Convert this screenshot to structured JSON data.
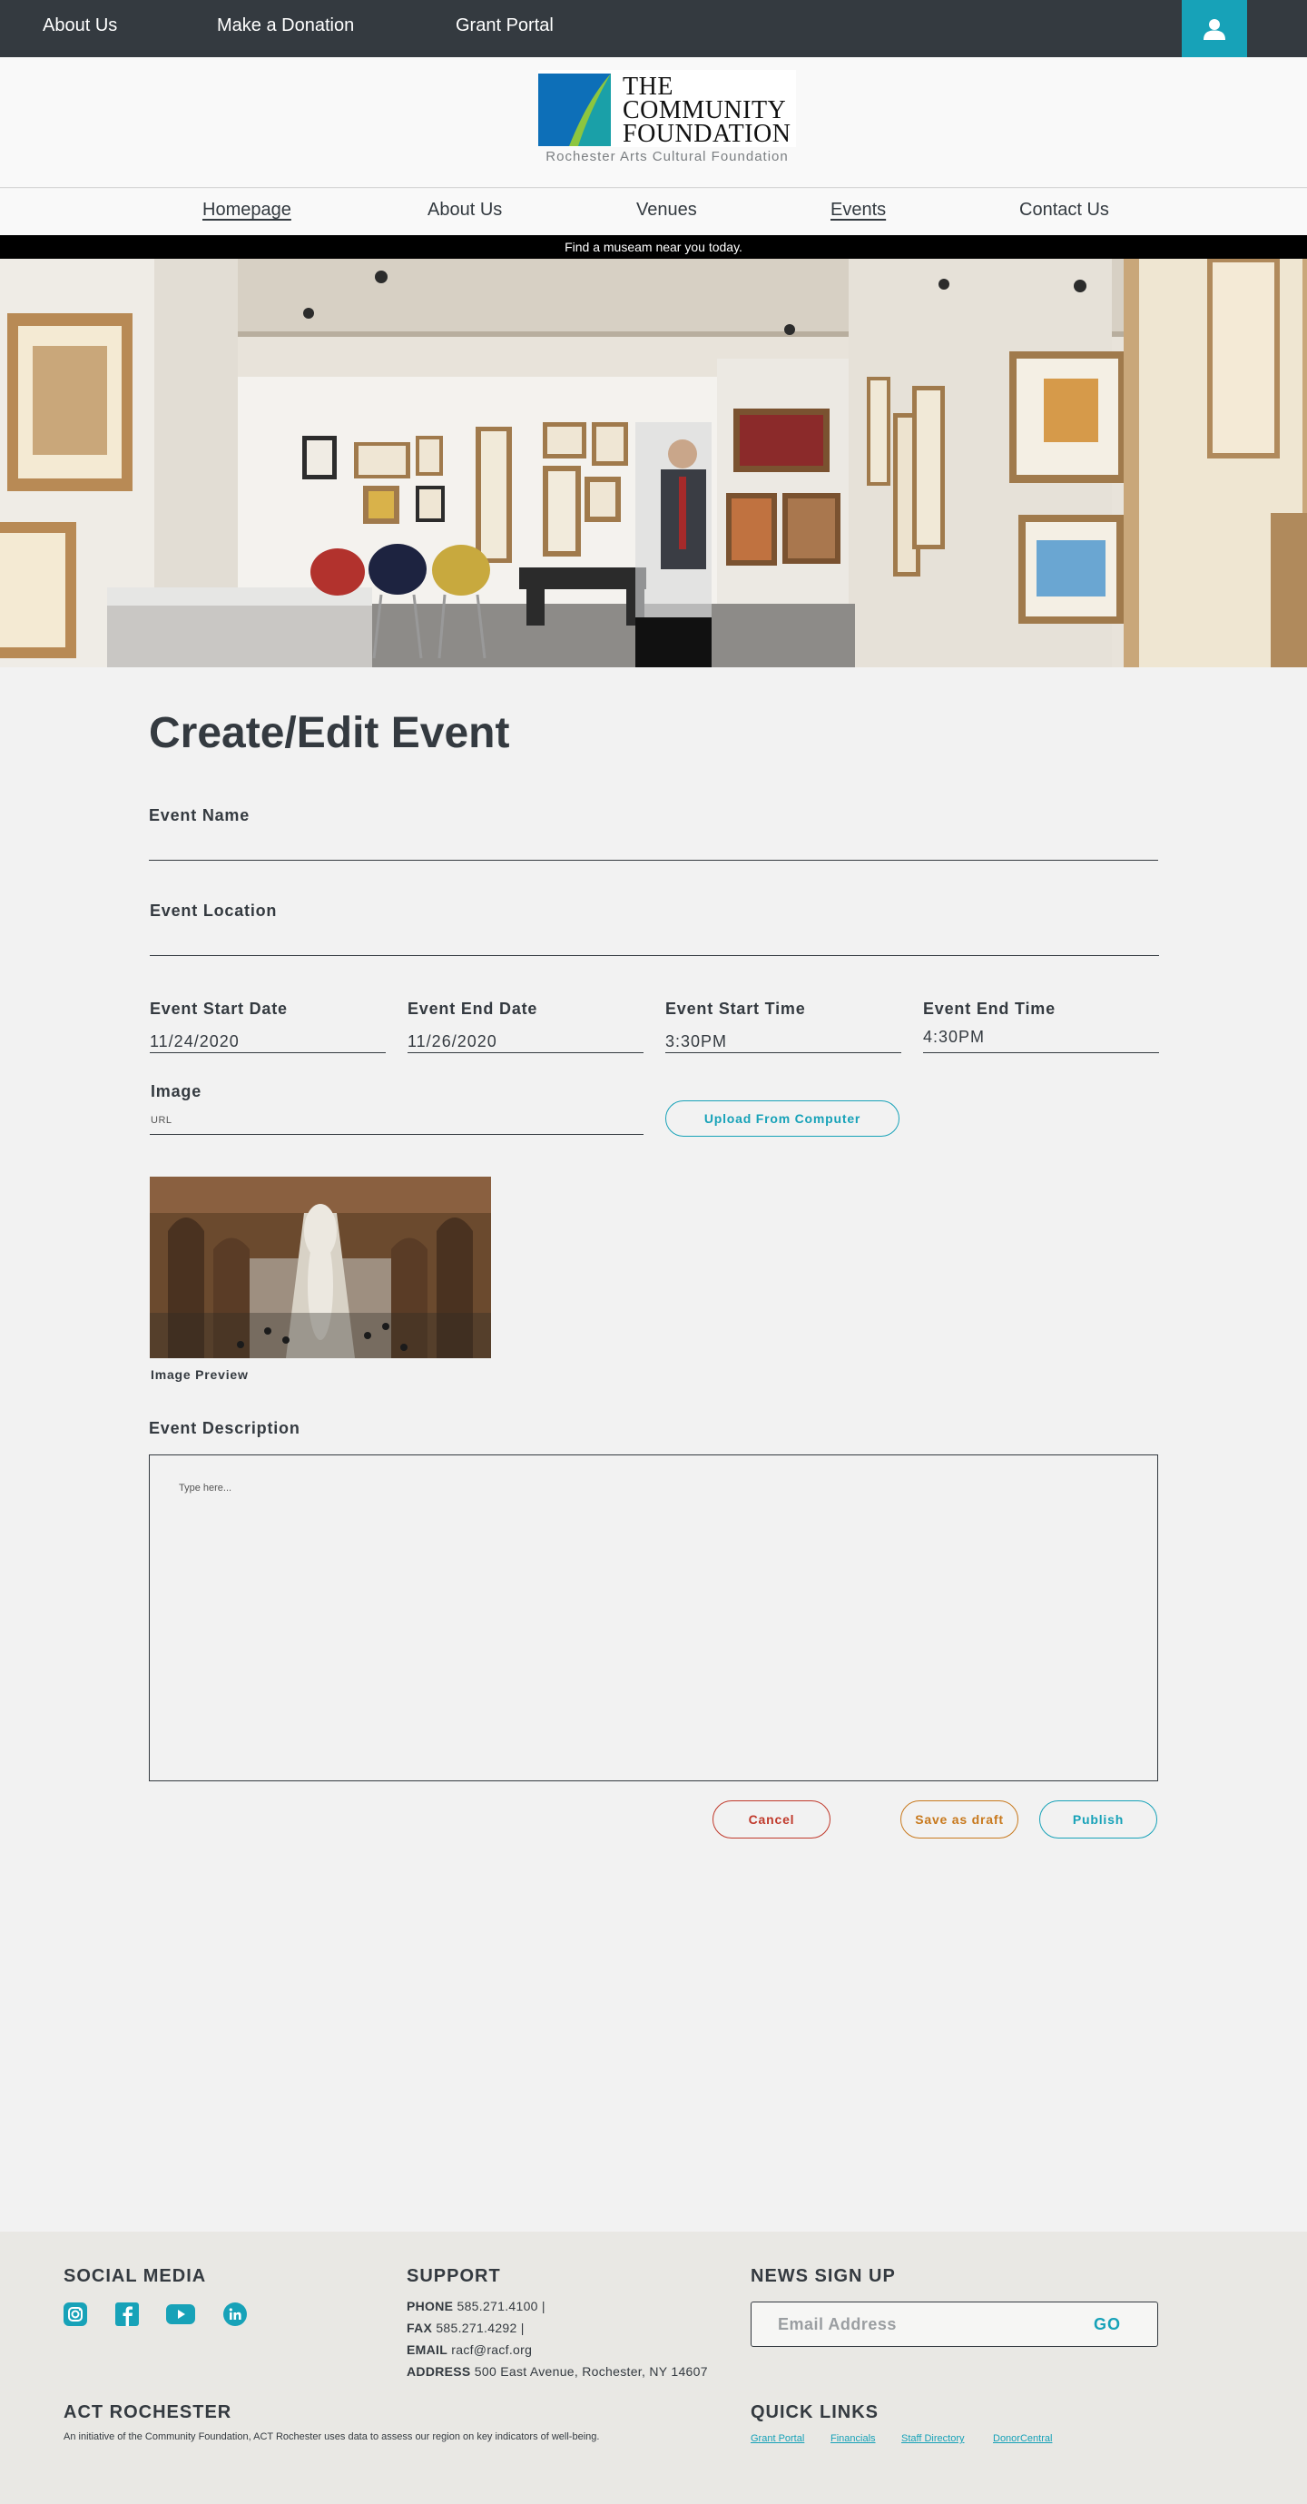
{
  "topbar": {
    "links": [
      "About Us",
      "Make a Donation",
      "Grant Portal"
    ],
    "user_icon": "user-icon",
    "accent": "#17a2b8",
    "background": "#343a40"
  },
  "logo": {
    "line1": "THE",
    "line2": "COMMUNITY",
    "line3": "FOUNDATION",
    "subtitle": "Rochester Arts Cultural Foundation"
  },
  "nav": {
    "items": [
      "Homepage",
      "About Us",
      "Venues",
      "Events",
      "Contact Us"
    ]
  },
  "promo": "Find a museam near you today.",
  "form": {
    "title": "Create/Edit Event",
    "event_name_label": "Event Name",
    "event_name_value": "",
    "event_location_label": "Event Location",
    "event_location_value": "",
    "start_date_label": "Event Start Date",
    "start_date_value": "11/24/2020",
    "end_date_label": "Event End Date",
    "end_date_value": "11/26/2020",
    "start_time_label": "Event Start Time",
    "start_time_value": "3:30PM",
    "end_time_label": "Event End Time",
    "end_time_value": "4:30PM",
    "image_label": "Image",
    "image_placeholder": "URL",
    "upload_button": "Upload From Computer",
    "preview_caption": "Image Preview",
    "description_label": "Event Description",
    "description_placeholder": "Type here...",
    "cancel_button": "Cancel",
    "draft_button": "Save as draft",
    "publish_button": "Publish"
  },
  "footer": {
    "social_title": "SOCIAL MEDIA",
    "social_icons": [
      "instagram-icon",
      "facebook-icon",
      "youtube-icon",
      "linkedin-icon"
    ],
    "support_title": "SUPPORT",
    "phone_label": "PHONE",
    "phone_value": "585.271.4100 |",
    "fax_label": "FAX",
    "fax_value": "585.271.4292 |",
    "email_label": "EMAIL",
    "email_value": "racf@racf.org",
    "address_label": "ADDRESS",
    "address_value": "500 East Avenue, Rochester, NY 14607",
    "news_title": "NEWS SIGN UP",
    "email_placeholder": "Email Address",
    "go_button": "GO",
    "act_title": "ACT ROCHESTER",
    "act_description": "An initiative of the Community Foundation, ACT Rochester uses data to assess our region on key indicators of well-being.",
    "quick_title": "QUICK LINKS",
    "quick_links": [
      "Grant Portal",
      "Financials",
      "Staff Directory",
      "DonorCentral"
    ]
  }
}
